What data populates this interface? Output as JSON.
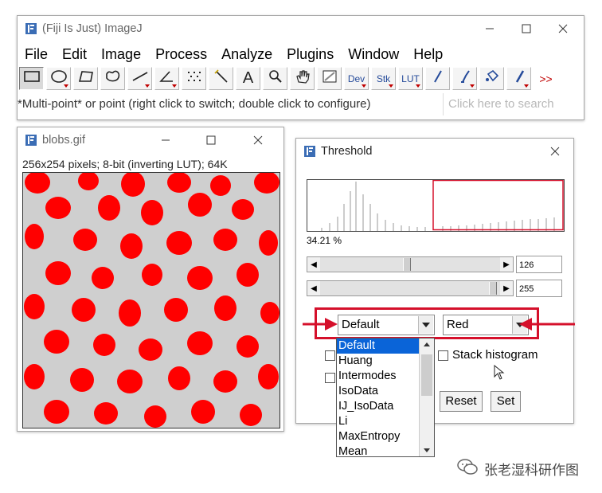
{
  "main_window": {
    "title": "(Fiji Is Just) ImageJ",
    "menus": [
      "File",
      "Edit",
      "Image",
      "Process",
      "Analyze",
      "Plugins",
      "Window",
      "Help"
    ],
    "tools": [
      {
        "name": "rectangle-tool"
      },
      {
        "name": "oval-tool"
      },
      {
        "name": "polygon-tool"
      },
      {
        "name": "freehand-tool"
      },
      {
        "name": "line-tool"
      },
      {
        "name": "angle-tool"
      },
      {
        "name": "multipoint-tool"
      },
      {
        "name": "wand-tool"
      },
      {
        "name": "text-tool",
        "label": "A"
      },
      {
        "name": "magnifier-tool"
      },
      {
        "name": "hand-tool"
      },
      {
        "name": "color-picker-tool"
      },
      {
        "name": "dev-tool",
        "label": "Dev"
      },
      {
        "name": "stk-tool",
        "label": "Stk"
      },
      {
        "name": "lut-tool",
        "label": "LUT"
      },
      {
        "name": "pencil-tool"
      },
      {
        "name": "brush-tool"
      },
      {
        "name": "flood-fill-tool"
      },
      {
        "name": "paintbrush-tool"
      },
      {
        "name": "more-tools",
        "label": ">>"
      }
    ],
    "status": "*Multi-point* or point (right click to switch; double click to configure)",
    "search_placeholder": "Click here to search"
  },
  "blobs_window": {
    "title": "blobs.gif",
    "info": "256x254 pixels; 8-bit (inverting LUT); 64K"
  },
  "threshold_window": {
    "title": "Threshold",
    "percent": "34.21 %",
    "min_value": "126",
    "max_value": "255",
    "method_selected": "Default",
    "display_selected": "Red",
    "stack_histogram_label": "Stack histogram",
    "reset_label": "Reset",
    "set_label": "Set",
    "methods": [
      "Default",
      "Huang",
      "Intermodes",
      "IsoData",
      "IJ_IsoData",
      "Li",
      "MaxEntropy",
      "Mean"
    ],
    "colors": {
      "highlight": "#d5102b",
      "overlay": "#ff0000"
    }
  },
  "watermark": "张老湿科研作图"
}
